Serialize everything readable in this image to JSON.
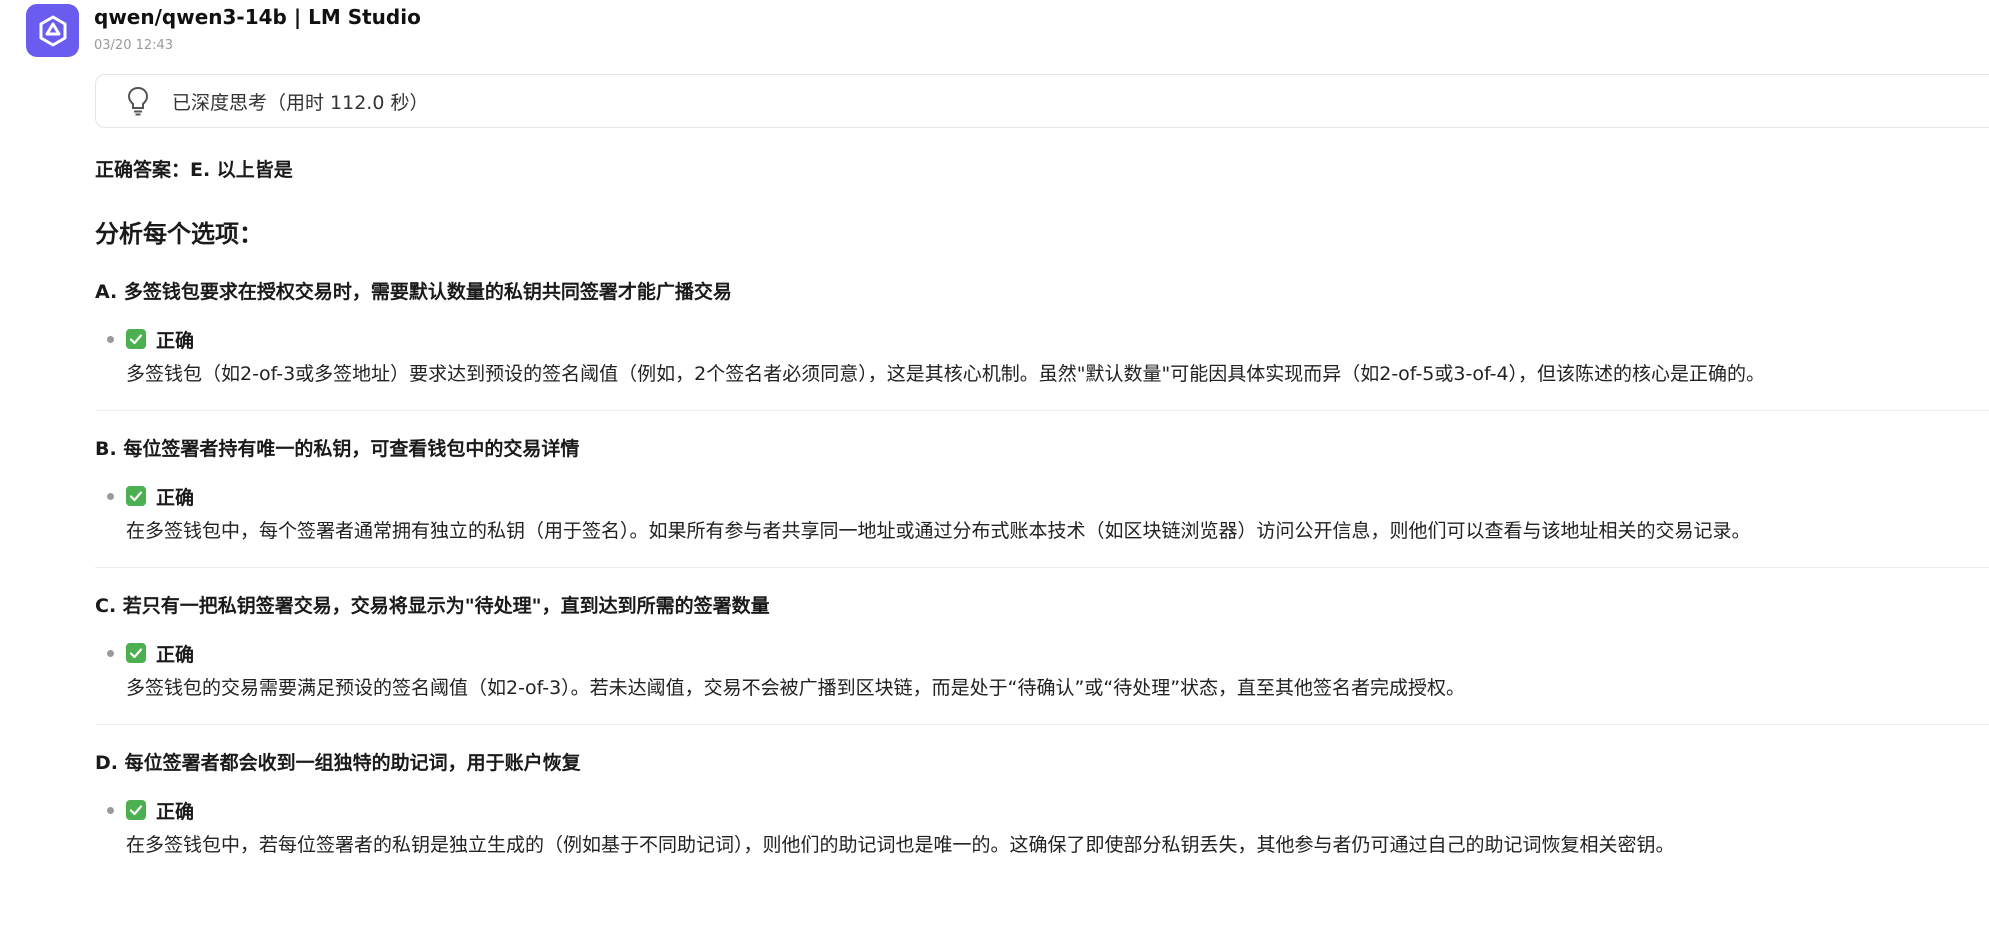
{
  "header": {
    "title": "qwen/qwen3-14b | LM Studio",
    "timestamp": "03/20 12:43",
    "avatar_icon": "qwen-logo-icon",
    "avatar_color": "#6b5cf0"
  },
  "thinking": {
    "icon": "lightbulb-icon",
    "label": "已深度思考（用时 112.0 秒）"
  },
  "answer": "正确答案：E. 以上皆是",
  "analysis_title": "分析每个选项：",
  "options": [
    {
      "title": "A. 多签钱包要求在授权交易时，需要默认数量的私钥共同签署才能广播交易",
      "verdict_icon": "check-mark-icon",
      "verdict": "正确",
      "description": "多签钱包（如2-of-3或多签地址）要求达到预设的签名阈值（例如，2个签名者必须同意），这是其核心机制。虽然\"默认数量\"可能因具体实现而异（如2-of-5或3-of-4），但该陈述的核心是正确的。"
    },
    {
      "title": "B. 每位签署者持有唯一的私钥，可查看钱包中的交易详情",
      "verdict_icon": "check-mark-icon",
      "verdict": "正确",
      "description": "在多签钱包中，每个签署者通常拥有独立的私钥（用于签名）。如果所有参与者共享同一地址或通过分布式账本技术（如区块链浏览器）访问公开信息，则他们可以查看与该地址相关的交易记录。"
    },
    {
      "title": "C. 若只有一把私钥签署交易，交易将显示为\"待处理\"，直到达到所需的签署数量",
      "verdict_icon": "check-mark-icon",
      "verdict": "正确",
      "description": "多签钱包的交易需要满足预设的签名阈值（如2-of-3）。若未达阈值，交易不会被广播到区块链，而是处于“待确认”或“待处理”状态，直至其他签名者完成授权。"
    },
    {
      "title": "D. 每位签署者都会收到一组独特的助记词，用于账户恢复",
      "verdict_icon": "check-mark-icon",
      "verdict": "正确",
      "description": "在多签钱包中，若每位签署者的私钥是独立生成的（例如基于不同助记词），则他们的助记词也是唯一的。这确保了即使部分私钥丢失，其他参与者仍可通过自己的助记词恢复相关密钥。"
    }
  ],
  "colors": {
    "check_green": "#4caf50",
    "divider": "#ececec"
  }
}
